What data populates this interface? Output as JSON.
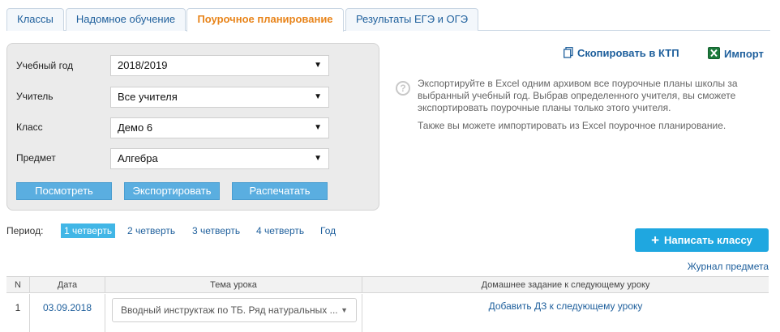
{
  "tabs": [
    {
      "label": "Классы",
      "active": false
    },
    {
      "label": "Надомное обучение",
      "active": false
    },
    {
      "label": "Поурочное планирование",
      "active": true
    },
    {
      "label": "Результаты ЕГЭ и ОГЭ",
      "active": false
    }
  ],
  "filters": {
    "year": {
      "label": "Учебный год",
      "value": "2018/2019"
    },
    "teacher": {
      "label": "Учитель",
      "value": "Все учителя"
    },
    "class": {
      "label": "Класс",
      "value": "Демо 6"
    },
    "subject": {
      "label": "Предмет",
      "value": "Алгебра"
    },
    "caret": "▼"
  },
  "buttons": {
    "view": "Посмотреть",
    "export": "Экспортировать",
    "print": "Распечатать"
  },
  "actions": {
    "copy_ktp": "Скопировать в КТП",
    "import": "Импорт"
  },
  "help": {
    "icon": "?",
    "text1": "Экспортируйте в Excel одним архивом все поурочные планы школы за выбранный учебный год. Выбрав определенного учителя, вы сможете экспортировать поурочные планы только этого учителя.",
    "text2": "Также вы можете импортировать из Excel поурочное планирование."
  },
  "period": {
    "label": "Период:",
    "options": [
      "1 четверть",
      "2 четверть",
      "3 четверть",
      "4 четверть",
      "Год"
    ],
    "selected": "1 четверть"
  },
  "write_class_button": "Написать классу",
  "journal_link": "Журнал предмета",
  "table": {
    "headers": [
      "N",
      "Дата",
      "Тема урока",
      "Домашнее задание к следующему уроку"
    ],
    "rows": [
      {
        "n": "1",
        "date": "03.09.2018",
        "topic": "Вводный инструктаж по ТБ. Ряд натуральных ...",
        "homework": "Добавить ДЗ к следующему уроку"
      }
    ]
  },
  "colors": {
    "accent": "#1fa7e0",
    "active_tab": "#e8841a",
    "link": "#1e5f9c",
    "panel_button": "#5aaee0"
  }
}
